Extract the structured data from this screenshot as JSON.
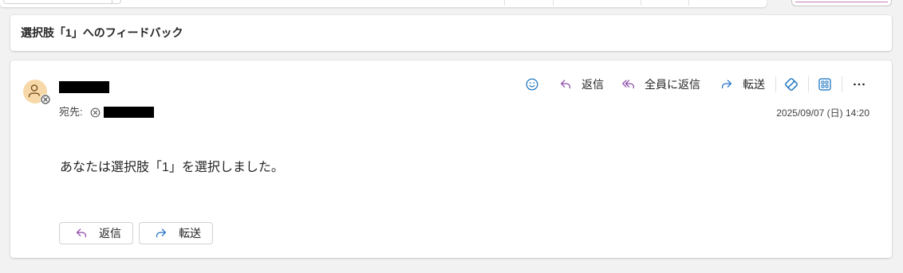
{
  "subject": {
    "title": "選択肢「1」へのフィードバック"
  },
  "message": {
    "recipient_label": "宛先:",
    "date": "2025/09/07 (日) 14:20",
    "body": "あなたは選択肢「1」を選択しました。"
  },
  "toolbar": {
    "reply_label": "返信",
    "reply_all_label": "全員に返信",
    "forward_label": "転送",
    "icons": [
      "smiley-icon",
      "reply-icon",
      "reply-all-icon",
      "forward-icon",
      "loop-icon",
      "apps-icon",
      "more-icon"
    ]
  },
  "quick_actions": {
    "reply_label": "返信",
    "forward_label": "転送"
  },
  "avatar": {
    "icon": "person-icon",
    "badge_icon": "blocked-badge-icon"
  },
  "colors": {
    "background": "#f2f2f2",
    "card": "#ffffff",
    "text": "#242424",
    "secondary_text": "#424242",
    "accent": "#0f6cbd",
    "reply_icon": "#8a48a8",
    "forward_icon": "#1f6fc5",
    "avatar_background": "#f7d9a9",
    "avatar_foreground": "#7a4f1e"
  }
}
